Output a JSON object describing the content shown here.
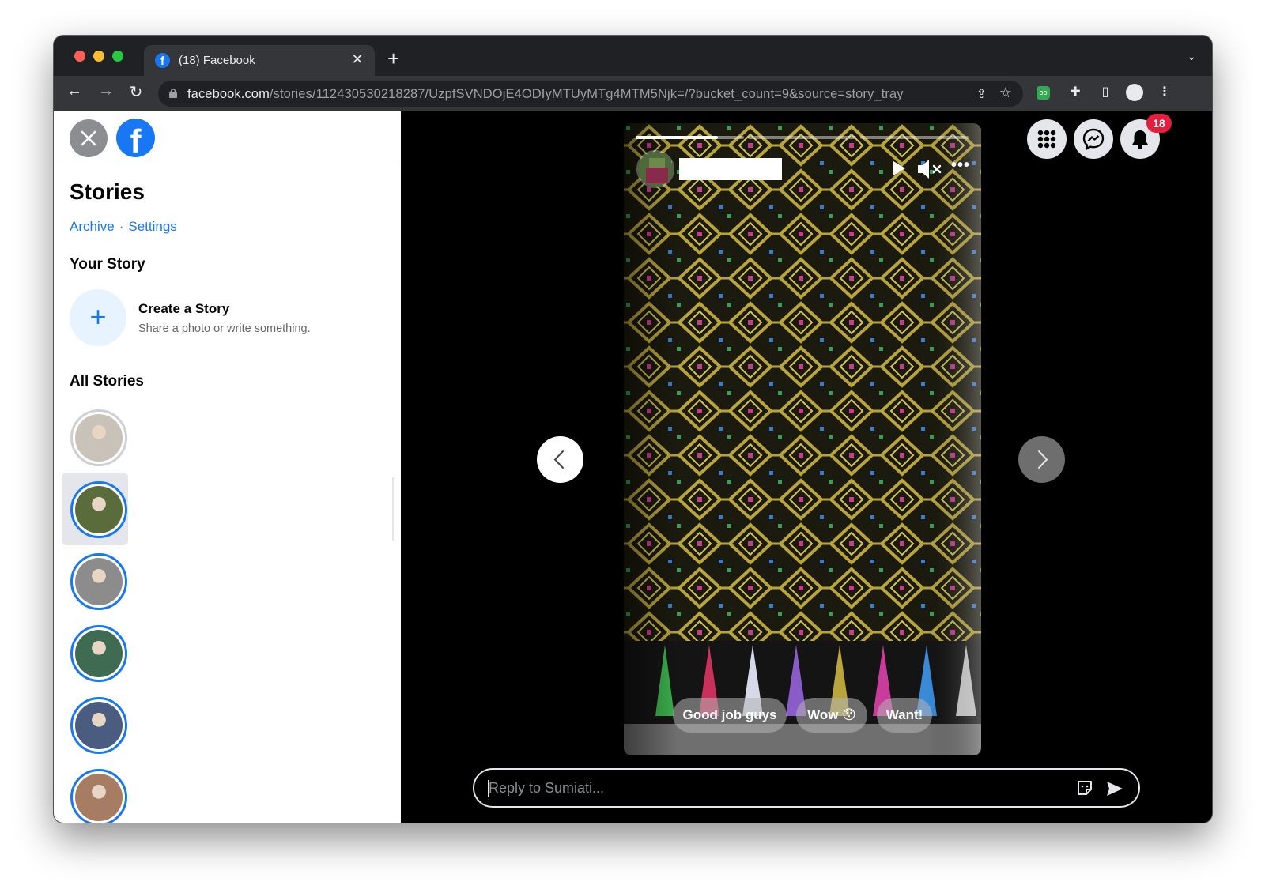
{
  "browser": {
    "tab_title": "(18) Facebook",
    "tab_close": "✕",
    "new_tab": "+",
    "url_host": "facebook.com",
    "url_path": "/stories/112430530218287/UzpfSVNDOjE4ODIyMTUyMTg4MTM5Njk=/?bucket_count=9&source=story_tray",
    "icons": [
      "back-icon",
      "forward-icon",
      "reload-icon",
      "lock-icon",
      "share-icon",
      "star-icon",
      "extension-icon",
      "puzzle-icon",
      "sidebar-icon",
      "profile-icon",
      "menu-icon"
    ]
  },
  "sidebar": {
    "title": "Stories",
    "archive_link": "Archive",
    "separator": "·",
    "settings_link": "Settings",
    "your_story_heading": "Your Story",
    "create_title": "Create a Story",
    "create_subtitle": "Share a photo or write something.",
    "all_stories_heading": "All Stories",
    "stories": [
      {
        "seen": true,
        "selected": false,
        "color": "#c9c2b8"
      },
      {
        "seen": false,
        "selected": true,
        "color": "#5a6b3c"
      },
      {
        "seen": false,
        "selected": false,
        "color": "#8c8c8c"
      },
      {
        "seen": false,
        "selected": false,
        "color": "#3f6b52"
      },
      {
        "seen": false,
        "selected": false,
        "color": "#4a5d80"
      },
      {
        "seen": false,
        "selected": false,
        "color": "#a67c63"
      }
    ]
  },
  "viewer": {
    "progress": [
      {
        "filled": 0.76
      },
      {
        "filled": 0
      },
      {
        "filled": 0
      }
    ],
    "quick_replies": [
      "Good job guys",
      "Wow 😯",
      "Want!"
    ],
    "reply_placeholder": "Reply to Sumiati...",
    "notification_count": "18",
    "top_icons": [
      "menu-grid-icon",
      "messenger-icon",
      "bell-icon"
    ]
  }
}
